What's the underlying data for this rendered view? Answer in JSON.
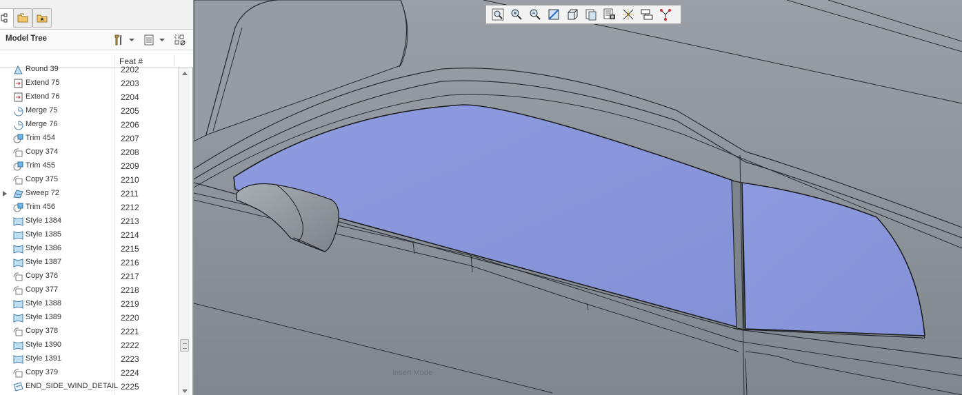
{
  "model_tree": {
    "title": "Model Tree",
    "column_feat": "Feat #",
    "rows": [
      {
        "name": "Round 39",
        "num": "2202",
        "icon": "round-icon"
      },
      {
        "name": "Extend 75",
        "num": "2203",
        "icon": "extend-icon"
      },
      {
        "name": "Extend 76",
        "num": "2204",
        "icon": "extend-icon"
      },
      {
        "name": "Merge 75",
        "num": "2205",
        "icon": "merge-icon"
      },
      {
        "name": "Merge 76",
        "num": "2206",
        "icon": "merge-icon"
      },
      {
        "name": "Trim 454",
        "num": "2207",
        "icon": "trim-icon"
      },
      {
        "name": "Copy 374",
        "num": "2208",
        "icon": "copy-icon"
      },
      {
        "name": "Trim 455",
        "num": "2209",
        "icon": "trim-icon"
      },
      {
        "name": "Copy 375",
        "num": "2210",
        "icon": "copy-icon"
      },
      {
        "name": "Sweep 72",
        "num": "2211",
        "icon": "sweep-icon"
      },
      {
        "name": "Trim 456",
        "num": "2212",
        "icon": "trim-icon"
      },
      {
        "name": "Style 1384",
        "num": "2213",
        "icon": "style-icon"
      },
      {
        "name": "Style 1385",
        "num": "2214",
        "icon": "style-icon"
      },
      {
        "name": "Style 1386",
        "num": "2215",
        "icon": "style-icon"
      },
      {
        "name": "Style 1387",
        "num": "2216",
        "icon": "style-icon"
      },
      {
        "name": "Copy 376",
        "num": "2217",
        "icon": "copy-icon"
      },
      {
        "name": "Copy 377",
        "num": "2218",
        "icon": "copy-icon"
      },
      {
        "name": "Style 1388",
        "num": "2219",
        "icon": "style-icon"
      },
      {
        "name": "Style 1389",
        "num": "2220",
        "icon": "style-icon"
      },
      {
        "name": "Copy 378",
        "num": "2221",
        "icon": "copy-icon"
      },
      {
        "name": "Style 1390",
        "num": "2222",
        "icon": "style-icon"
      },
      {
        "name": "Style 1391",
        "num": "2223",
        "icon": "style-icon"
      },
      {
        "name": "Copy 379",
        "num": "2224",
        "icon": "copy-icon"
      },
      {
        "name": "END_SIDE_WIND_DETAIL",
        "num": "2225",
        "icon": "end-marker-icon"
      }
    ]
  },
  "viewport": {
    "status_text": "Insert Mode",
    "toolbar_icons": [
      "zoom-fit-icon",
      "zoom-in-icon",
      "zoom-out-icon",
      "reorient-icon",
      "display-style-icon",
      "saved-views-icon",
      "view-manager-icon",
      "datum-display-icon",
      "annotation-display-icon",
      "spin-center-icon"
    ]
  },
  "colors": {
    "glass": "#8c98dc",
    "body": "#8e959c",
    "panel": "#ffffff"
  }
}
